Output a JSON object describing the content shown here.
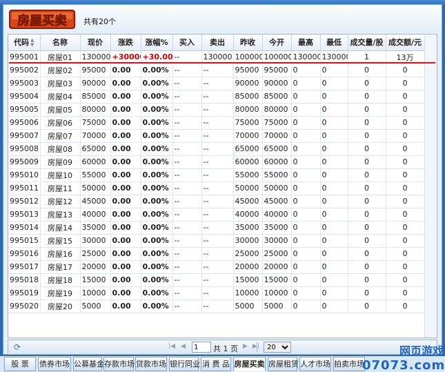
{
  "header": {
    "logo_text": "房屋买卖",
    "count_text": "共有20个"
  },
  "table": {
    "columns": [
      "代码",
      "名称",
      "现价",
      "涨跌",
      "涨幅%",
      "买入",
      "卖出",
      "昨收",
      "今开",
      "最高",
      "最低",
      "成交量/股",
      "成交额/元"
    ],
    "rows": [
      [
        "995001",
        "房屋01",
        "130000",
        "+30000.0",
        "+30.00%",
        "--",
        "130000",
        "100000",
        "100000",
        "130000",
        "130000",
        "1",
        "13万"
      ],
      [
        "995002",
        "房屋02",
        "95000",
        "0.00",
        "0.00%",
        "--",
        "--",
        "95000",
        "95000",
        "0",
        "0",
        "0",
        "0"
      ],
      [
        "995003",
        "房屋03",
        "90000",
        "0.00",
        "0.00%",
        "--",
        "--",
        "90000",
        "90000",
        "0",
        "0",
        "0",
        "0"
      ],
      [
        "995004",
        "房屋04",
        "85000",
        "0.00",
        "0.00%",
        "--",
        "--",
        "85000",
        "85000",
        "0",
        "0",
        "0",
        "0"
      ],
      [
        "995005",
        "房屋05",
        "80000",
        "0.00",
        "0.00%",
        "--",
        "--",
        "80000",
        "80000",
        "0",
        "0",
        "0",
        "0"
      ],
      [
        "995006",
        "房屋06",
        "75000",
        "0.00",
        "0.00%",
        "--",
        "--",
        "75000",
        "75000",
        "0",
        "0",
        "0",
        "0"
      ],
      [
        "995007",
        "房屋07",
        "70000",
        "0.00",
        "0.00%",
        "--",
        "--",
        "70000",
        "70000",
        "0",
        "0",
        "0",
        "0"
      ],
      [
        "995008",
        "房屋08",
        "65000",
        "0.00",
        "0.00%",
        "--",
        "--",
        "65000",
        "65000",
        "0",
        "0",
        "0",
        "0"
      ],
      [
        "995009",
        "房屋09",
        "60000",
        "0.00",
        "0.00%",
        "--",
        "--",
        "60000",
        "60000",
        "0",
        "0",
        "0",
        "0"
      ],
      [
        "995010",
        "房屋10",
        "55000",
        "0.00",
        "0.00%",
        "--",
        "--",
        "55000",
        "55000",
        "0",
        "0",
        "0",
        "0"
      ],
      [
        "995011",
        "房屋11",
        "50000",
        "0.00",
        "0.00%",
        "--",
        "--",
        "50000",
        "50000",
        "0",
        "0",
        "0",
        "0"
      ],
      [
        "995012",
        "房屋12",
        "45000",
        "0.00",
        "0.00%",
        "--",
        "--",
        "45000",
        "45000",
        "0",
        "0",
        "0",
        "0"
      ],
      [
        "995013",
        "房屋13",
        "40000",
        "0.00",
        "0.00%",
        "--",
        "--",
        "40000",
        "40000",
        "0",
        "0",
        "0",
        "0"
      ],
      [
        "995014",
        "房屋14",
        "35000",
        "0.00",
        "0.00%",
        "--",
        "--",
        "35000",
        "35000",
        "0",
        "0",
        "0",
        "0"
      ],
      [
        "995015",
        "房屋15",
        "30000",
        "0.00",
        "0.00%",
        "--",
        "--",
        "30000",
        "30000",
        "0",
        "0",
        "0",
        "0"
      ],
      [
        "995016",
        "房屋16",
        "25000",
        "0.00",
        "0.00%",
        "--",
        "--",
        "25000",
        "25000",
        "0",
        "0",
        "0",
        "0"
      ],
      [
        "995017",
        "房屋17",
        "20000",
        "0.00",
        "0.00%",
        "--",
        "--",
        "20000",
        "20000",
        "0",
        "0",
        "0",
        "0"
      ],
      [
        "995018",
        "房屋18",
        "15000",
        "0.00",
        "0.00%",
        "--",
        "--",
        "15000",
        "15000",
        "0",
        "0",
        "0",
        "0"
      ],
      [
        "995019",
        "房屋19",
        "10000",
        "0.00",
        "0.00%",
        "--",
        "--",
        "10000",
        "10000",
        "0",
        "0",
        "0",
        "0"
      ],
      [
        "995020",
        "房屋20",
        "5000",
        "0.00",
        "0.00%",
        "--",
        "--",
        "5000",
        "5000",
        "0",
        "0",
        "0",
        "0"
      ]
    ]
  },
  "pager": {
    "page_value": "1",
    "pages_text": "共 1 页",
    "page_size": "20"
  },
  "tabs": [
    "股  票",
    "债券市场",
    "公募基金",
    "存款市场",
    "贷款市场",
    "银行同业",
    "消 费 品",
    "房屋买卖",
    "房屋租赁",
    "人才市场",
    "拍卖市场"
  ],
  "active_tab": "房屋买卖",
  "watermark": {
    "line1": "网页游戏",
    "line2": "07073.com"
  },
  "colors": {
    "up": "#d40000",
    "frame_blue": "#2a6ab0",
    "highlight_line": "#d81818"
  }
}
